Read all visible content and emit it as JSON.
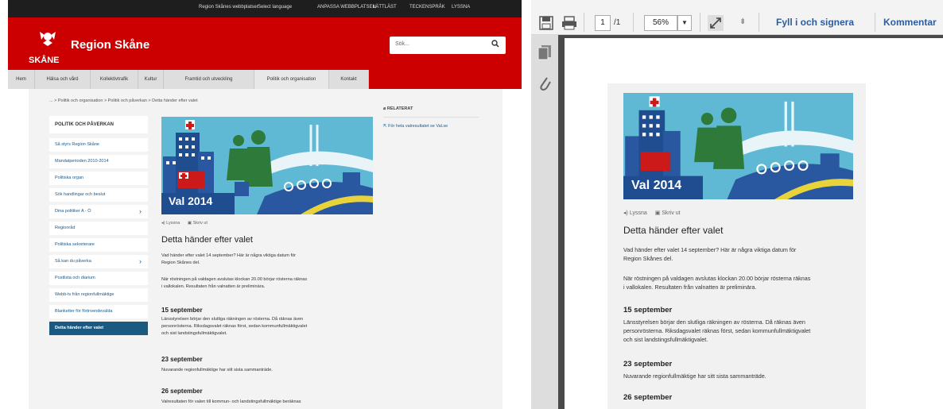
{
  "site": {
    "top_links": [
      "Region Skånes webbplatser",
      "Select language",
      "ANPASSA WEBBPLATSEN",
      "LÄTTLÄST",
      "TECKENSPRÅK",
      "LYSSNA"
    ],
    "logo_text": "SKÅNE",
    "brand": "Region Skåne",
    "search_placeholder": "Sök...",
    "nav": [
      "Hem",
      "Hälsa och vård",
      "Kollektivtrafik",
      "Kultur",
      "Framtid och utveckling",
      "Politik och organisation",
      "Kontakt"
    ],
    "breadcrumb": "... > Politik och organisation > Politik och påverkan > Detta händer efter valet",
    "sidebar_heading": "POLITIK OCH PÅVERKAN",
    "sidebar": [
      {
        "label": "Så styrs Region Skåne",
        "chev": ""
      },
      {
        "label": "Mandatperioden 2010-2014",
        "chev": ""
      },
      {
        "label": "Politiska organ",
        "chev": ""
      },
      {
        "label": "Sök handlingar och beslut",
        "chev": ""
      },
      {
        "label": "Dina politiker A - Ö",
        "chev": "›"
      },
      {
        "label": "Regionråd",
        "chev": ""
      },
      {
        "label": "Politiska sekreterare",
        "chev": ""
      },
      {
        "label": "Så kan du påverka",
        "chev": "›"
      },
      {
        "label": "Postlista och diarium",
        "chev": ""
      },
      {
        "label": "Webb-tv från regionfullmäktige",
        "chev": ""
      },
      {
        "label": "Blanketter för förtroendevalda",
        "chev": ""
      },
      {
        "label": "Detta händer efter valet",
        "chev": ""
      }
    ],
    "related_heading": "RELATERAT",
    "related_link": "För hela valresultatet se Val.se"
  },
  "article": {
    "banner_text": "Val 2014",
    "listen": "Lyssna",
    "print": "Skriv ut",
    "title": "Detta händer efter valet",
    "intro_line1": "Vad händer efter valet 14 september? Här är några viktiga datum för",
    "intro_line2": "Region Skånes del.",
    "p2_line1": "När röstningen på valdagen avslutas klockan 20.00 börjar rösterna räknas",
    "p2_line2": "i vallokalen. Resultaten från valnatten är preliminära.",
    "d1": "15 september",
    "d1_line1": "Länsstyrelsen börjar den slutliga räkningen av rösterna. Då räknas även",
    "d1_line2": "personrösterna. Riksdagsvalet räknas först, sedan kommunfullmäktigvalet",
    "d1_line3": "och sist landstingsfullmäktigvalet.",
    "d2": "23 september",
    "d2_line1": "Nuvarande regionfullmäktige har sitt sista sammanträde.",
    "d3": "26 september",
    "d3_line1": "Valresultaten för valen till kommun- och landstingsfullmäktige beräknas"
  },
  "pdf": {
    "page_current": "1",
    "page_total": "/1",
    "zoom": "56%",
    "fill_sign": "Fyll i och signera",
    "comment": "Kommentar"
  },
  "colors": {
    "brand_red": "#cc0000",
    "active_blue": "#1a5a82",
    "link_blue": "#1a5a8a"
  }
}
